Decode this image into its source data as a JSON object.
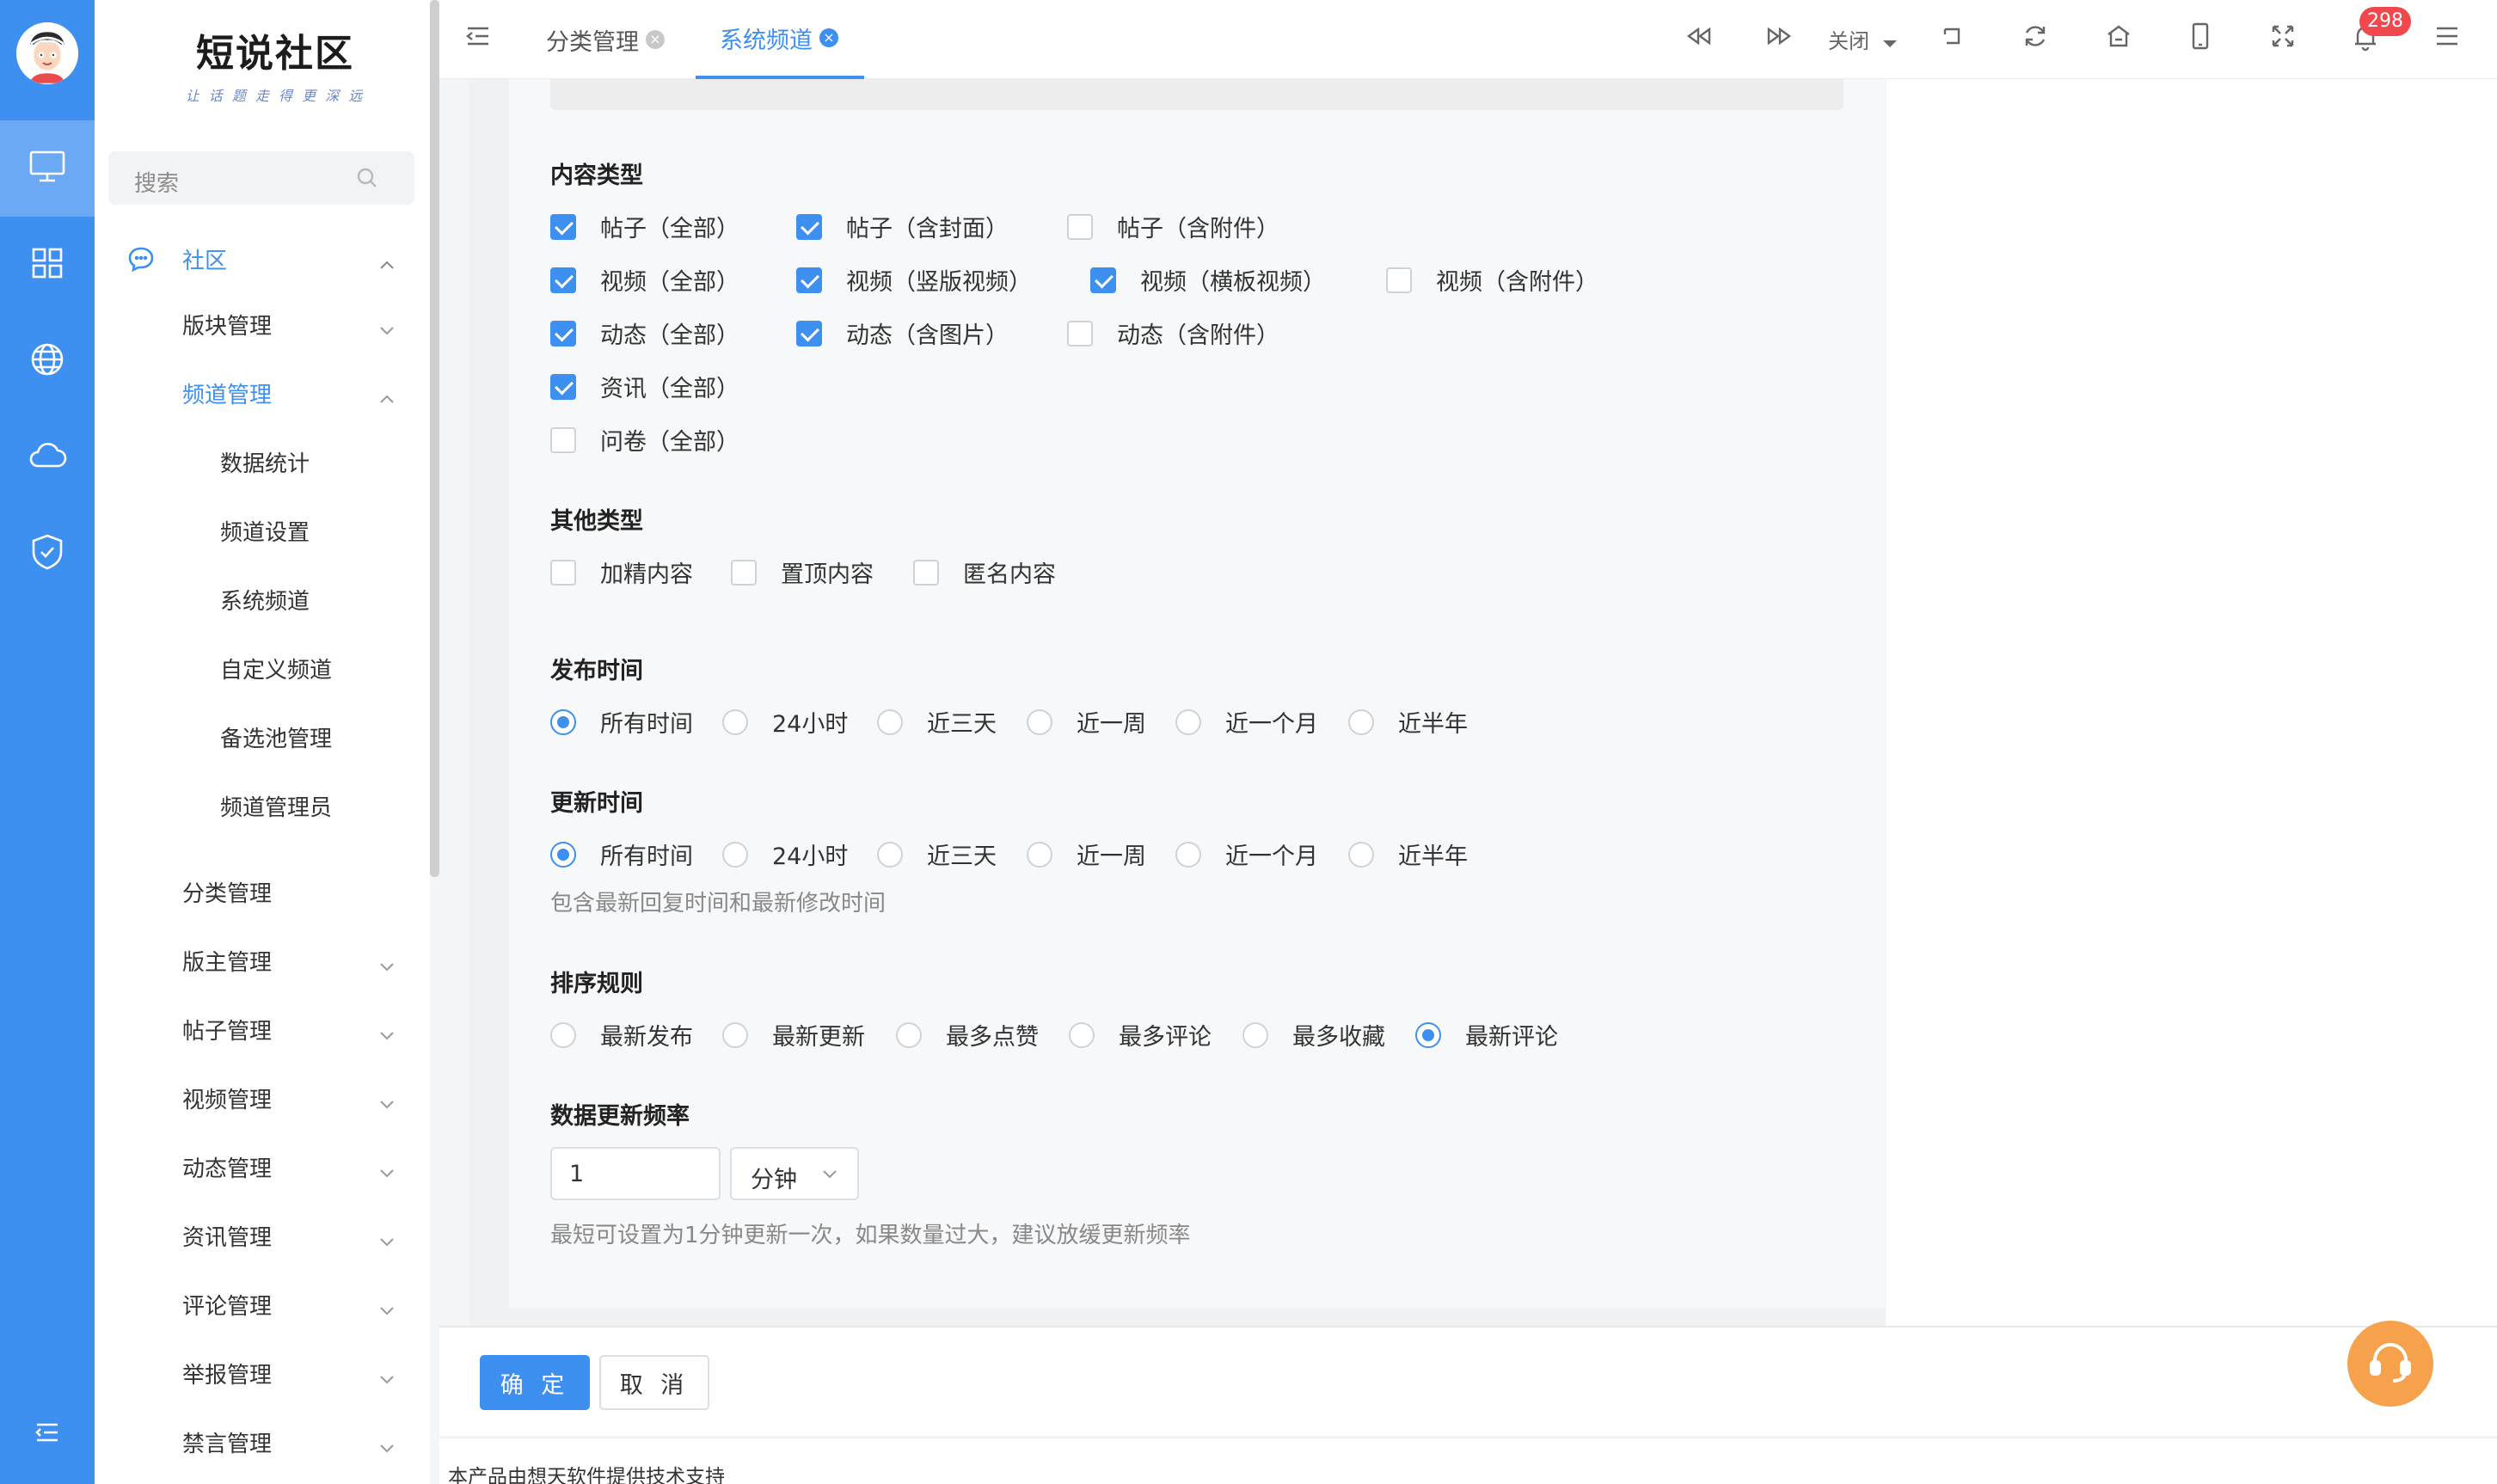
{
  "brand": {
    "title": "短说社区",
    "subtitle": "让 话 题 走 得 更 深 远"
  },
  "rail": {
    "items": [
      "desktop-icon",
      "apps-icon",
      "globe-icon",
      "cloud-icon",
      "shield-icon",
      "menu-fold-icon"
    ],
    "active": 0
  },
  "search": {
    "placeholder": "搜索"
  },
  "menu": {
    "root": "社区",
    "items": [
      {
        "label": "版块管理"
      },
      {
        "label": "频道管理"
      },
      {
        "label": "数据统计"
      },
      {
        "label": "频道设置"
      },
      {
        "label": "系统频道"
      },
      {
        "label": "自定义频道"
      },
      {
        "label": "备选池管理"
      },
      {
        "label": "频道管理员"
      },
      {
        "label": "分类管理"
      },
      {
        "label": "版主管理"
      },
      {
        "label": "帖子管理"
      },
      {
        "label": "视频管理"
      },
      {
        "label": "动态管理"
      },
      {
        "label": "资讯管理"
      },
      {
        "label": "评论管理"
      },
      {
        "label": "举报管理"
      },
      {
        "label": "禁言管理"
      }
    ]
  },
  "tabs": [
    {
      "label": "分类管理",
      "active": false
    },
    {
      "label": "系统频道",
      "active": true
    }
  ],
  "toolbar": {
    "close_label": "关闭",
    "notification_count": "298"
  },
  "form": {
    "content_type": {
      "title": "内容类型",
      "rows": [
        [
          {
            "label": "帖子（全部）",
            "checked": true
          },
          {
            "label": "帖子（含封面）",
            "checked": true
          },
          {
            "label": "帖子（含附件）",
            "checked": false
          }
        ],
        [
          {
            "label": "视频（全部）",
            "checked": true
          },
          {
            "label": "视频（竖版视频）",
            "checked": true
          },
          {
            "label": "视频（横板视频）",
            "checked": true
          },
          {
            "label": "视频（含附件）",
            "checked": false
          }
        ],
        [
          {
            "label": "动态（全部）",
            "checked": true
          },
          {
            "label": "动态（含图片）",
            "checked": true
          },
          {
            "label": "动态（含附件）",
            "checked": false
          }
        ],
        [
          {
            "label": "资讯（全部）",
            "checked": true
          }
        ],
        [
          {
            "label": "问卷（全部）",
            "checked": false
          }
        ]
      ]
    },
    "other_type": {
      "title": "其他类型",
      "options": [
        {
          "label": "加精内容",
          "checked": false
        },
        {
          "label": "置顶内容",
          "checked": false
        },
        {
          "label": "匿名内容",
          "checked": false
        }
      ]
    },
    "publish_time": {
      "title": "发布时间",
      "options": [
        "所有时间",
        "24小时",
        "近三天",
        "近一周",
        "近一个月",
        "近半年"
      ],
      "selected": 0
    },
    "update_time": {
      "title": "更新时间",
      "options": [
        "所有时间",
        "24小时",
        "近三天",
        "近一周",
        "近一个月",
        "近半年"
      ],
      "selected": 0,
      "hint": "包含最新回复时间和最新修改时间"
    },
    "sort_rule": {
      "title": "排序规则",
      "options": [
        "最新发布",
        "最新更新",
        "最多点赞",
        "最多评论",
        "最多收藏",
        "最新评论"
      ],
      "selected": 5
    },
    "refresh_rate": {
      "title": "数据更新频率",
      "value": "1",
      "unit": "分钟",
      "hint": "最短可设置为1分钟更新一次，如果数量过大，建议放缓更新频率"
    }
  },
  "actions": {
    "confirm": "确 定",
    "cancel": "取 消"
  },
  "footer": {
    "text": "本产品由想天软件提供技术支持"
  },
  "colors": {
    "accent": "#3d8ff0",
    "rail": "#3d8ff0",
    "badge": "#f0484d",
    "support": "#f6a14b"
  }
}
